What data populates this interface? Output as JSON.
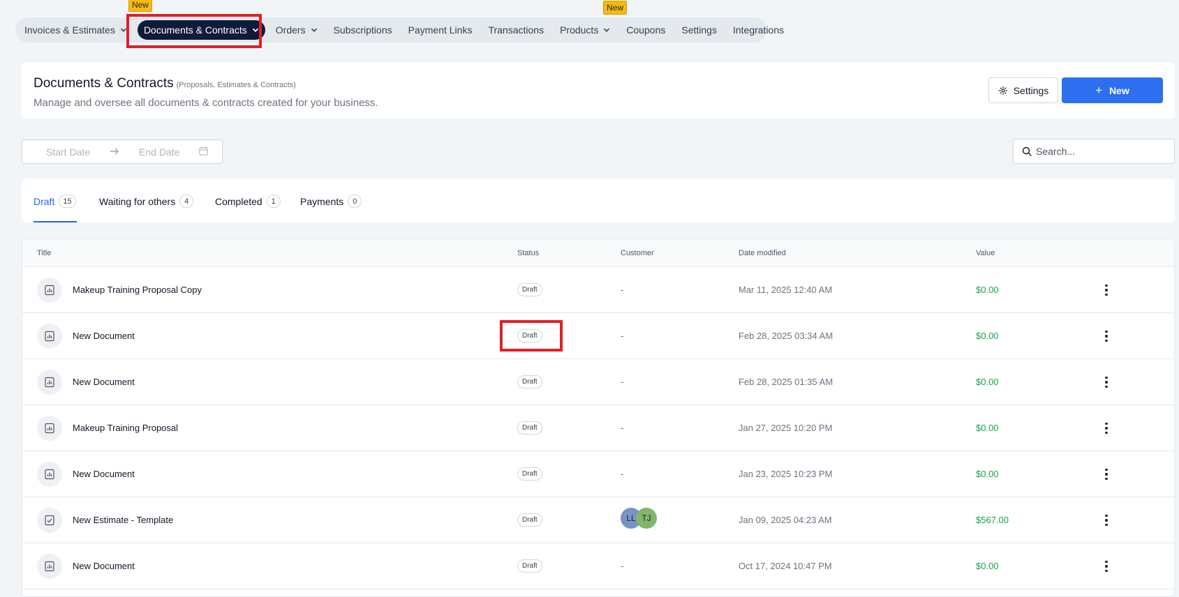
{
  "nav": {
    "items": [
      {
        "label": "Invoices & Estimates",
        "chevron": true,
        "badge": ""
      },
      {
        "label": "Documents & Contracts",
        "chevron": true,
        "badge": "New",
        "active": true
      },
      {
        "label": "Orders",
        "chevron": true,
        "badge": ""
      },
      {
        "label": "Subscriptions",
        "chevron": false,
        "badge": ""
      },
      {
        "label": "Payment Links",
        "chevron": false,
        "badge": ""
      },
      {
        "label": "Transactions",
        "chevron": false,
        "badge": ""
      },
      {
        "label": "Products",
        "chevron": true,
        "badge": "New"
      },
      {
        "label": "Coupons",
        "chevron": false,
        "badge": ""
      },
      {
        "label": "Settings",
        "chevron": false,
        "badge": ""
      },
      {
        "label": "Integrations",
        "chevron": false,
        "badge": ""
      }
    ]
  },
  "header": {
    "title": "Documents & Contracts",
    "subtitle": "(Proposals, Estimates & Contracts)",
    "description": "Manage and oversee all documents & contracts created for your business.",
    "settings_label": "Settings",
    "new_label": "New"
  },
  "filters": {
    "start_placeholder": "Start Date",
    "end_placeholder": "End Date",
    "search_placeholder": "Search..."
  },
  "tabs": [
    {
      "label": "Draft",
      "count": "15"
    },
    {
      "label": "Waiting for others",
      "count": "4"
    },
    {
      "label": "Completed",
      "count": "1"
    },
    {
      "label": "Payments",
      "count": "0"
    }
  ],
  "table": {
    "headers": {
      "title": "Title",
      "status": "Status",
      "customer": "Customer",
      "date": "Date modified",
      "value": "Value"
    },
    "rows": [
      {
        "title": "Makeup Training Proposal Copy",
        "status": "Draft",
        "customer": "-",
        "date": "Mar 11, 2025 12:40 AM",
        "value": "$0.00",
        "icon": "chart-doc-icon"
      },
      {
        "title": "New Document",
        "status": "Draft",
        "customer": "-",
        "date": "Feb 28, 2025 03:34 AM",
        "value": "$0.00",
        "icon": "chart-doc-icon"
      },
      {
        "title": "New Document",
        "status": "Draft",
        "customer": "-",
        "date": "Feb 28, 2025 01:35 AM",
        "value": "$0.00",
        "icon": "chart-doc-icon"
      },
      {
        "title": "Makeup Training Proposal",
        "status": "Draft",
        "customer": "-",
        "date": "Jan 27, 2025 10:20 PM",
        "value": "$0.00",
        "icon": "chart-doc-icon"
      },
      {
        "title": "New Document",
        "status": "Draft",
        "customer": "-",
        "date": "Jan 23, 2025 10:23 PM",
        "value": "$0.00",
        "icon": "chart-doc-icon"
      },
      {
        "title": "New Estimate - Template",
        "status": "Draft",
        "customer": "",
        "avatars": [
          "LL",
          "TJ"
        ],
        "date": "Jan 09, 2025 04:23 AM",
        "value": "$567.00",
        "icon": "checklist-doc-icon"
      },
      {
        "title": "New Document",
        "status": "Draft",
        "customer": "-",
        "date": "Oct 17, 2024 10:47 PM",
        "value": "$0.00",
        "icon": "chart-doc-icon"
      }
    ]
  },
  "colors": {
    "accent": "#2e6ff0",
    "nav_active_bg": "#101a3a",
    "badge": "#f5b912",
    "value_green": "#16a34a",
    "highlight": "#e01f26",
    "avatar_ll": "#7b93c2",
    "avatar_tj": "#82b46a"
  }
}
